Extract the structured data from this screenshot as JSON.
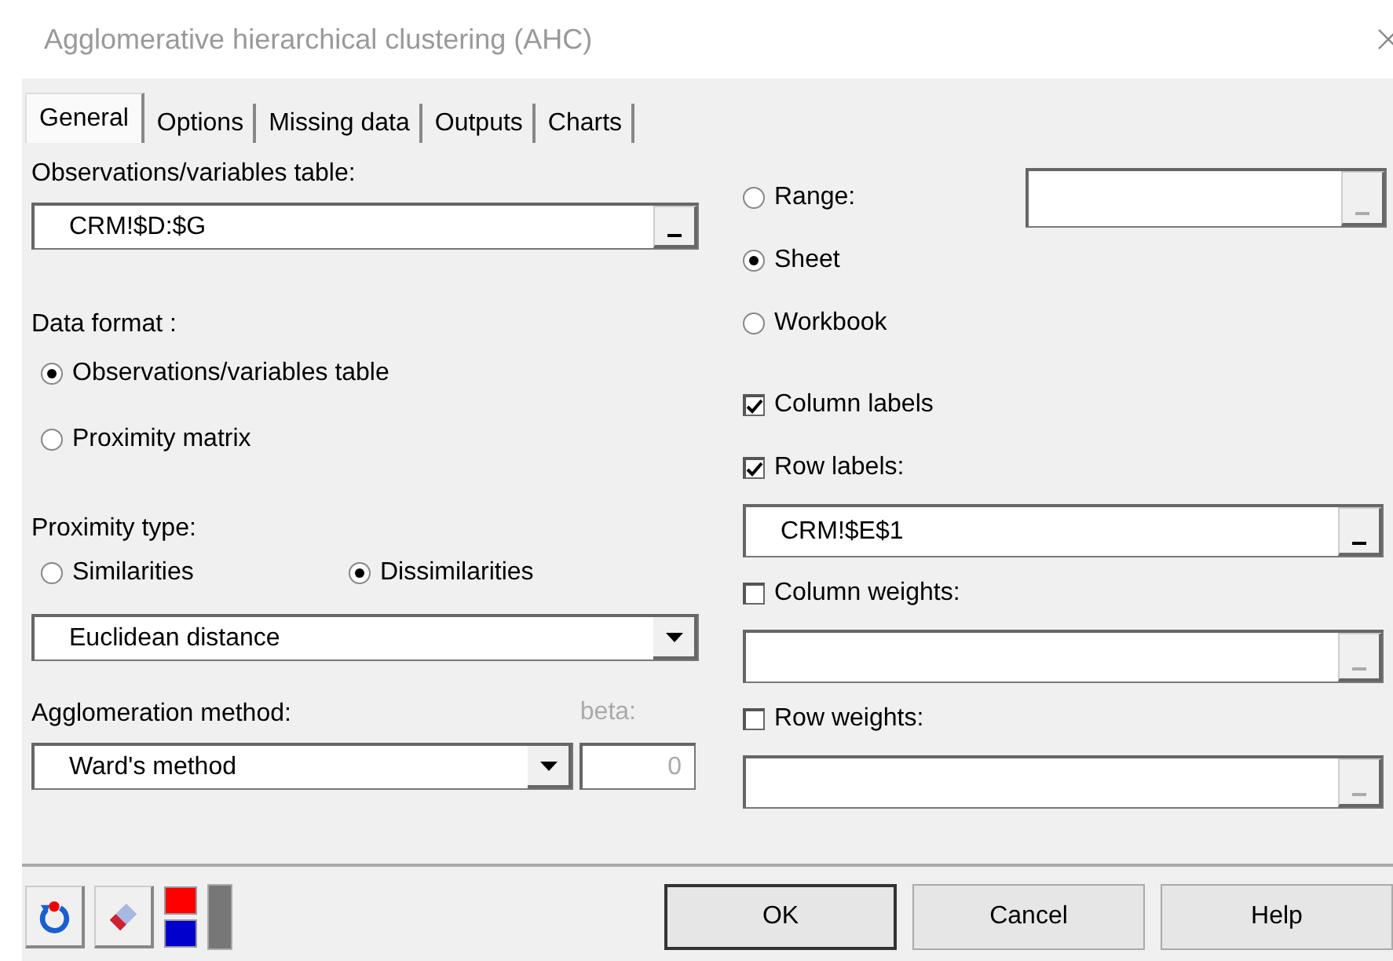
{
  "window": {
    "title": "Agglomerative hierarchical clustering (AHC)"
  },
  "tabs": [
    {
      "label": "General",
      "selected": true
    },
    {
      "label": "Options",
      "selected": false
    },
    {
      "label": "Missing data",
      "selected": false
    },
    {
      "label": "Outputs",
      "selected": false
    },
    {
      "label": "Charts",
      "selected": false
    }
  ],
  "observations": {
    "label": "Observations/variables table:",
    "value": "CRM!$D:$G",
    "disabled": false
  },
  "data_format": {
    "label": "Data format :",
    "options": [
      {
        "label": "Observations/variables table",
        "selected": true
      },
      {
        "label": "Proximity matrix",
        "selected": false
      }
    ]
  },
  "proximity": {
    "label": "Proximity type:",
    "options": [
      {
        "label": "Similarities",
        "selected": false
      },
      {
        "label": "Dissimilarities",
        "selected": true
      }
    ],
    "dropdown": "Euclidean distance"
  },
  "agglomeration": {
    "label": "Agglomeration method:",
    "dropdown": "Ward's method",
    "beta_label": "beta:",
    "beta_value": "0"
  },
  "right": [
    {
      "kind": "radio",
      "label": "Range:",
      "selected": false,
      "field": {
        "disabled": true
      }
    },
    {
      "kind": "radio",
      "label": "Sheet",
      "selected": true
    },
    {
      "kind": "radio",
      "label": "Workbook",
      "selected": false
    },
    {
      "kind": "checkbox",
      "label": "Column labels",
      "checked": true
    },
    {
      "kind": "checkbox",
      "label": "Row labels:",
      "checked": true
    },
    {
      "kind": "field",
      "value": "CRM!$E$1",
      "disabled": false
    },
    {
      "kind": "checkbox",
      "label": "Column weights:",
      "checked": false
    },
    {
      "kind": "field",
      "disabled": true
    },
    {
      "kind": "checkbox",
      "label": "Row weights:",
      "checked": false
    },
    {
      "kind": "field",
      "disabled": true
    }
  ],
  "buttons": [
    {
      "label": "OK",
      "default": true
    },
    {
      "label": "Cancel",
      "default": false
    },
    {
      "label": "Help",
      "default": false
    }
  ]
}
